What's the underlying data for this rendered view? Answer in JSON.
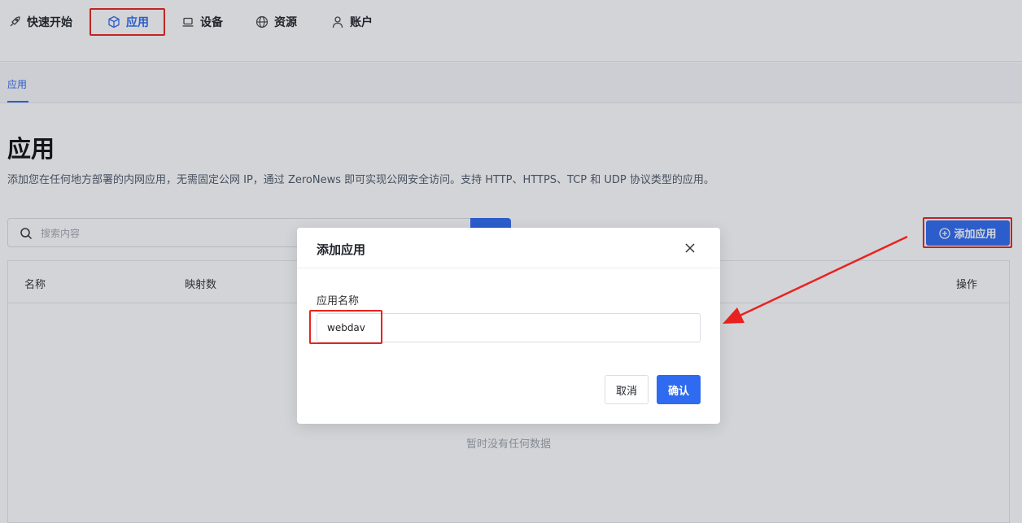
{
  "nav": {
    "items": [
      {
        "label": "快速开始",
        "icon": "rocket-icon"
      },
      {
        "label": "应用",
        "icon": "cube-icon"
      },
      {
        "label": "设备",
        "icon": "laptop-icon"
      },
      {
        "label": "资源",
        "icon": "globe-icon"
      },
      {
        "label": "账户",
        "icon": "user-icon"
      }
    ],
    "active": "应用"
  },
  "subtabs": {
    "active_label": "应用"
  },
  "page": {
    "title": "应用",
    "description": "添加您在任何地方部署的内网应用，无需固定公网 IP，通过 ZeroNews 即可实现公网安全访问。支持 HTTP、HTTPS、TCP 和 UDP 协议类型的应用。"
  },
  "search": {
    "placeholder": "搜索内容",
    "icon": "search-icon"
  },
  "toolbar": {
    "add_label": "添加应用",
    "add_icon": "plus-circle-icon"
  },
  "table": {
    "columns": [
      "名称",
      "映射数",
      "操作"
    ],
    "empty_text": "暂时没有任何数据"
  },
  "modal": {
    "title": "添加应用",
    "field_label": "应用名称",
    "field_value": "webdav",
    "cancel_label": "取消",
    "confirm_label": "确认",
    "close_icon": "close-icon"
  },
  "colors": {
    "accent": "#2f6bf0",
    "highlight": "#e8231f"
  }
}
